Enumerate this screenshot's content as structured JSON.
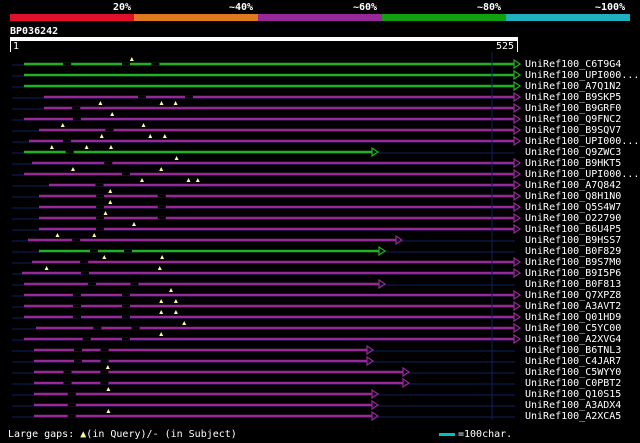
{
  "legend": {
    "colors": [
      "#e0102a",
      "#e07820",
      "#982898",
      "#10a010",
      "#20b0c0"
    ],
    "labels": [
      "20%",
      "~40%",
      "~60%",
      "~80%",
      "~100%"
    ]
  },
  "query": {
    "id": "BP036242",
    "start": "1",
    "end": "525"
  },
  "hits": [
    {
      "name": "UniRef100_C6T9G4",
      "color": "#20b020",
      "gaps_query": [
        0.22
      ],
      "gaps_subject": [
        0.08,
        0.2,
        0.26
      ]
    },
    {
      "name": "UniRef100_UPI000...",
      "color": "#20b020",
      "gaps_query": [],
      "gaps_subject": []
    },
    {
      "name": "UniRef100_A7Q1N2",
      "color": "#20b020",
      "gaps_query": [],
      "gaps_subject": []
    },
    {
      "name": "UniRef100_B9SKP5",
      "color": "#982898",
      "gaps_query": [],
      "gaps_subject": [
        0.2,
        0.3
      ]
    },
    {
      "name": "UniRef100_B9GRF0",
      "color": "#982898",
      "gaps_query": [
        0.12,
        0.25,
        0.28
      ],
      "gaps_subject": [
        0.06
      ]
    },
    {
      "name": "UniRef100_Q9FNC2",
      "color": "#982898",
      "gaps_query": [
        0.18
      ],
      "gaps_subject": [
        0.1
      ]
    },
    {
      "name": "UniRef100_B9SQV7",
      "color": "#982898",
      "gaps_query": [
        0.05,
        0.22
      ],
      "gaps_subject": [
        0.14
      ]
    },
    {
      "name": "UniRef100_UPI000...",
      "color": "#982898",
      "gaps_query": [
        0.15,
        0.25,
        0.28
      ],
      "gaps_subject": [
        0.07
      ]
    },
    {
      "name": "UniRef100_Q9ZWC3",
      "color": "#20b020",
      "gaps_query": [
        0.08,
        0.18,
        0.25
      ],
      "gaps_subject": [
        0.12
      ]
    },
    {
      "name": "UniRef100_B9HKT5",
      "color": "#982898",
      "gaps_query": [
        0.3
      ],
      "gaps_subject": [
        0.15
      ]
    },
    {
      "name": "UniRef100_UPI000...",
      "color": "#982898",
      "gaps_query": [
        0.1,
        0.28
      ],
      "gaps_subject": [
        0.2
      ]
    },
    {
      "name": "UniRef100_A7Q842",
      "color": "#982898",
      "gaps_query": [
        0.2,
        0.3,
        0.32
      ],
      "gaps_subject": [
        0.1
      ]
    },
    {
      "name": "UniRef100_Q8H1N0",
      "color": "#982898",
      "gaps_query": [
        0.15
      ],
      "gaps_subject": [
        0.12,
        0.25
      ]
    },
    {
      "name": "UniRef100_Q5S4W7",
      "color": "#982898",
      "gaps_query": [
        0.15
      ],
      "gaps_subject": [
        0.12,
        0.25
      ]
    },
    {
      "name": "UniRef100_O22790",
      "color": "#982898",
      "gaps_query": [
        0.14
      ],
      "gaps_subject": [
        0.12,
        0.25
      ]
    },
    {
      "name": "UniRef100_B6U4P5",
      "color": "#982898",
      "gaps_query": [
        0.2
      ],
      "gaps_subject": [
        0.12
      ]
    },
    {
      "name": "UniRef100_B9HSS7",
      "color": "#982898",
      "gaps_query": [
        0.08,
        0.18
      ],
      "gaps_subject": [
        0.12
      ]
    },
    {
      "name": "UniRef100_B0F829",
      "color": "#20b020",
      "gaps_query": [],
      "gaps_subject": [
        0.15,
        0.25
      ]
    },
    {
      "name": "UniRef100_B9S7M0",
      "color": "#982898",
      "gaps_query": [
        0.15,
        0.27
      ],
      "gaps_subject": [
        0.1
      ]
    },
    {
      "name": "UniRef100_B9I5P6",
      "color": "#982898",
      "gaps_query": [
        0.05,
        0.28
      ],
      "gaps_subject": [
        0.12
      ]
    },
    {
      "name": "UniRef100_B0F813",
      "color": "#982898",
      "gaps_query": [],
      "gaps_subject": [
        0.18,
        0.3
      ]
    },
    {
      "name": "UniRef100_Q7XPZ8",
      "color": "#982898",
      "gaps_query": [
        0.3
      ],
      "gaps_subject": [
        0.1,
        0.2
      ]
    },
    {
      "name": "UniRef100_A3AVT2",
      "color": "#982898",
      "gaps_query": [
        0.28,
        0.31
      ],
      "gaps_subject": [
        0.1,
        0.2
      ]
    },
    {
      "name": "UniRef100_Q01HD9",
      "color": "#982898",
      "gaps_query": [
        0.28,
        0.31
      ],
      "gaps_subject": [
        0.1,
        0.2
      ]
    },
    {
      "name": "UniRef100_C5YC00",
      "color": "#982898",
      "gaps_query": [
        0.31
      ],
      "gaps_subject": [
        0.12,
        0.2
      ]
    },
    {
      "name": "UniRef100_A2XVG4",
      "color": "#982898",
      "gaps_query": [
        0.28
      ],
      "gaps_subject": [
        0.12,
        0.2
      ]
    },
    {
      "name": "UniRef100_B6TNL3",
      "color": "#982898",
      "gaps_query": [],
      "gaps_subject": [
        0.12,
        0.2
      ]
    },
    {
      "name": "UniRef100_C4JAR7",
      "color": "#982898",
      "gaps_query": [],
      "gaps_subject": [
        0.12,
        0.2
      ]
    },
    {
      "name": "UniRef100_C5WYY0",
      "color": "#982898",
      "gaps_query": [
        0.2
      ],
      "gaps_subject": [
        0.08,
        0.18
      ]
    },
    {
      "name": "UniRef100_C0PBT2",
      "color": "#982898",
      "gaps_query": [],
      "gaps_subject": [
        0.08,
        0.18
      ]
    },
    {
      "name": "UniRef100_Q10S15",
      "color": "#982898",
      "gaps_query": [
        0.22
      ],
      "gaps_subject": [
        0.1
      ]
    },
    {
      "name": "UniRef100_A3ADX4",
      "color": "#982898",
      "gaps_query": [],
      "gaps_subject": [
        0.1
      ]
    },
    {
      "name": "UniRef100_A2XCA5",
      "color": "#982898",
      "gaps_query": [
        0.22
      ],
      "gaps_subject": [
        0.1
      ]
    }
  ],
  "footer": {
    "prefix": "Large gaps:",
    "query_text": "(in Query)/",
    "subject_text": "- (in Subject)",
    "scale_text": "=100char."
  }
}
